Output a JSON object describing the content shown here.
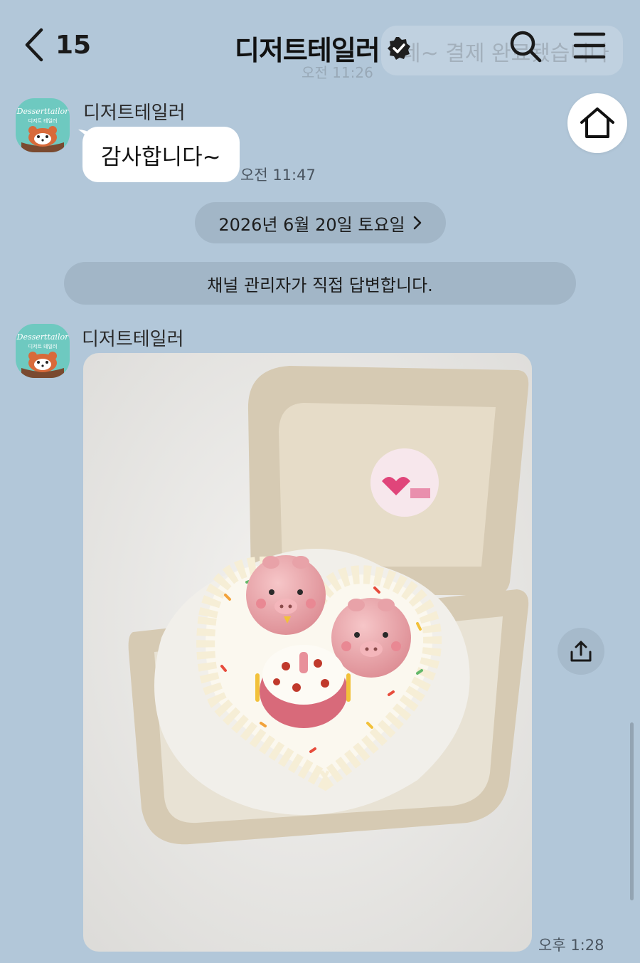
{
  "header": {
    "back_count": "15",
    "title": "디저트테일러"
  },
  "background_message": {
    "text": "네~ 결제 완료됐습니다",
    "time": "오전 11:26"
  },
  "messages": [
    {
      "sender": "디저트테일러",
      "text": "감사합니다~",
      "time": "오전 11:47"
    },
    {
      "sender": "디저트테일러",
      "type": "image",
      "time": "오후 1:28"
    }
  ],
  "date_divider": "2026년 6월 20일 토요일",
  "notice": "채널 관리자가 직접 답변합니다.",
  "avatar": {
    "brand": "Desserttailor",
    "brand_ko": "디저트 테일러"
  },
  "colors": {
    "chat_background": "#b2c7d9",
    "avatar_teal": "#6ec9c0",
    "chip": "#a2b6c7"
  },
  "icons": [
    "chevron-left-icon",
    "verified-badge-icon",
    "search-icon",
    "menu-icon",
    "home-icon",
    "chevron-right-icon",
    "share-icon"
  ]
}
